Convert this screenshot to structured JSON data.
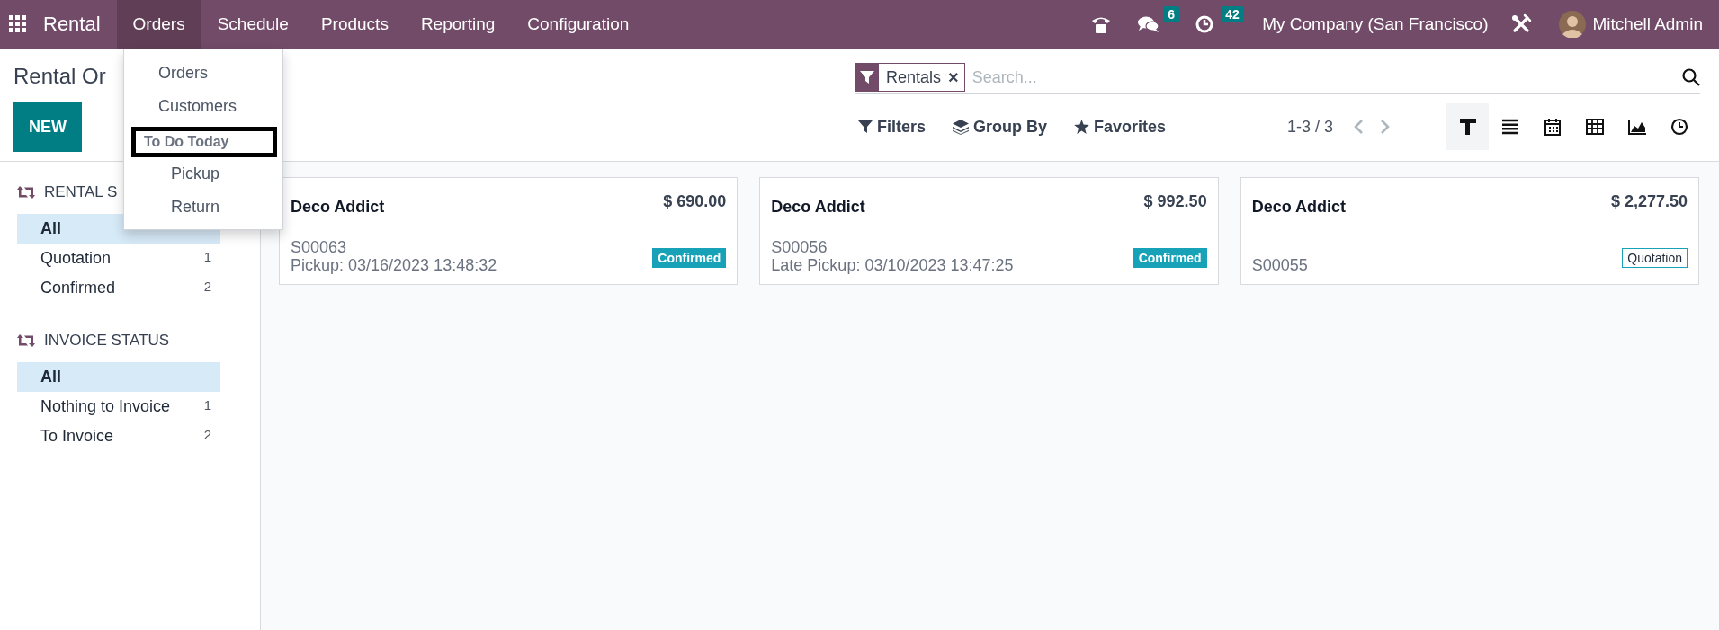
{
  "navbar": {
    "app_name": "Rental",
    "menus": [
      {
        "label": "Orders",
        "selected": true
      },
      {
        "label": "Schedule",
        "selected": false
      },
      {
        "label": "Products",
        "selected": false
      },
      {
        "label": "Reporting",
        "selected": false
      },
      {
        "label": "Configuration",
        "selected": false
      }
    ],
    "messages_count": "6",
    "activities_count": "42",
    "company": "My Company (San Francisco)",
    "user": "Mitchell Admin"
  },
  "dropdown": {
    "items": [
      {
        "kind": "item",
        "label": "Orders",
        "highlighted": false
      },
      {
        "kind": "item",
        "label": "Customers",
        "highlighted": false
      },
      {
        "kind": "header",
        "label": "To Do Today",
        "highlighted": true
      },
      {
        "kind": "subitem",
        "label": "Pickup",
        "highlighted": false
      },
      {
        "kind": "subitem",
        "label": "Return",
        "highlighted": false
      }
    ]
  },
  "breadcrumb": "Rental Or",
  "new_button": "NEW",
  "search": {
    "facets": [
      {
        "label": "Rentals",
        "remove": "×"
      }
    ],
    "placeholder": "Search..."
  },
  "search_options": [
    {
      "kind": "filter",
      "label": "Filters"
    },
    {
      "kind": "group",
      "label": "Group By"
    },
    {
      "kind": "favorite",
      "label": "Favorites"
    }
  ],
  "pager": "1-3 / 3",
  "views": [
    {
      "kind": "kanban",
      "selected": true
    },
    {
      "kind": "list",
      "selected": false
    },
    {
      "kind": "calendar",
      "selected": false
    },
    {
      "kind": "pivot",
      "selected": false
    },
    {
      "kind": "graph",
      "selected": false
    },
    {
      "kind": "activity",
      "selected": false
    }
  ],
  "sidebar": {
    "sections": [
      {
        "title": "RENTAL S",
        "items": [
          {
            "label": "All",
            "selected": true
          },
          {
            "label": "Quotation",
            "count": "1",
            "selected": false
          },
          {
            "label": "Confirmed",
            "count": "2",
            "selected": false
          }
        ]
      },
      {
        "title": "INVOICE STATUS",
        "items": [
          {
            "label": "All",
            "selected": true
          },
          {
            "label": "Nothing to Invoice",
            "count": "1",
            "selected": false
          },
          {
            "label": "To Invoice",
            "count": "2",
            "selected": false
          }
        ]
      }
    ]
  },
  "cards": [
    {
      "customer": "Deco Addict",
      "amount": "$ 690.00",
      "reference": "S00063",
      "date_line": "Pickup: 03/16/2023 13:48:32",
      "status": {
        "kind": "confirmed",
        "label": "Confirmed"
      }
    },
    {
      "customer": "Deco Addict",
      "amount": "$ 992.50",
      "reference": "S00056",
      "date_line": "Late Pickup: 03/10/2023 13:47:25",
      "status": {
        "kind": "confirmed",
        "label": "Confirmed"
      }
    },
    {
      "customer": "Deco Addict",
      "amount": "$ 2,277.50",
      "reference": "S00055",
      "status": {
        "kind": "quotation",
        "label": "Quotation"
      }
    }
  ]
}
